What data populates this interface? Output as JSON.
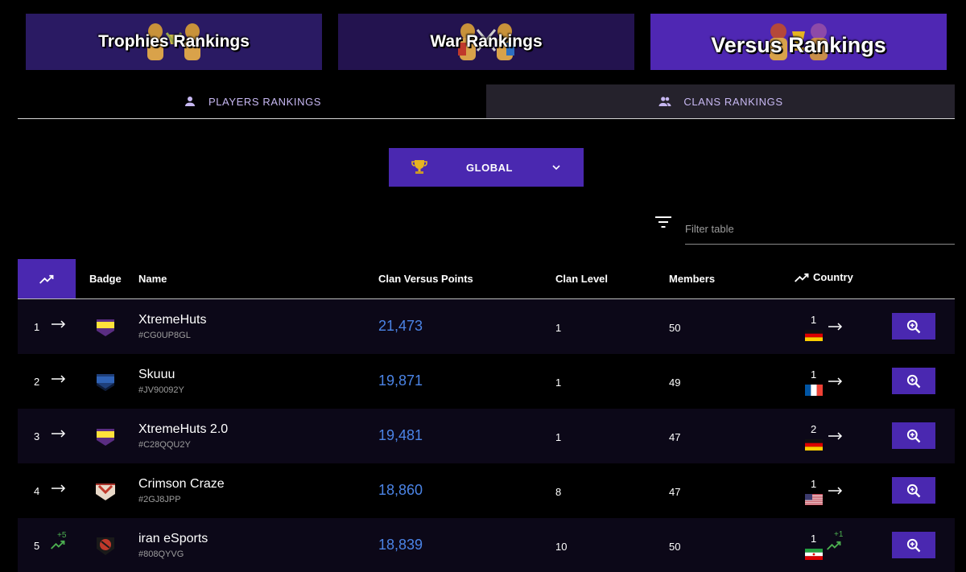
{
  "banners": {
    "trophies": "Trophies Rankings",
    "war": "War Rankings",
    "versus": "Versus Rankings"
  },
  "tabs": {
    "players": "PLAYERS RANKINGS",
    "clans": "CLANS RANKINGS"
  },
  "location": {
    "label": "GLOBAL"
  },
  "filter": {
    "placeholder": "Filter table"
  },
  "columns": {
    "badge": "Badge",
    "name": "Name",
    "points": "Clan Versus Points",
    "level": "Clan Level",
    "members": "Members",
    "country": "Country"
  },
  "rows": [
    {
      "rank": "1",
      "name": "XtremeHuts",
      "tag": "#CG0UP8GL",
      "points": "21,473",
      "level": "1",
      "members": "50",
      "country_rank": "1",
      "country": "Germany"
    },
    {
      "rank": "2",
      "name": "Skuuu",
      "tag": "#JV90092Y",
      "points": "19,871",
      "level": "1",
      "members": "49",
      "country_rank": "1",
      "country": "France"
    },
    {
      "rank": "3",
      "name": "XtremeHuts 2.0",
      "tag": "#C28QQU2Y",
      "points": "19,481",
      "level": "1",
      "members": "47",
      "country_rank": "2",
      "country": "Germany"
    },
    {
      "rank": "4",
      "name": "Crimson Craze",
      "tag": "#2GJ8JPP",
      "points": "18,860",
      "level": "8",
      "members": "47",
      "country_rank": "1",
      "country": "United States"
    },
    {
      "rank": "5",
      "rank_change": "+5",
      "name": "iran eSports",
      "tag": "#808QYVG",
      "points": "18,839",
      "level": "10",
      "members": "50",
      "country_rank": "1",
      "country_change": "+1",
      "country": "Iran"
    }
  ],
  "colors": {
    "accent": "#4a28b0",
    "points": "#4b84e6",
    "up": "#4caf50"
  }
}
